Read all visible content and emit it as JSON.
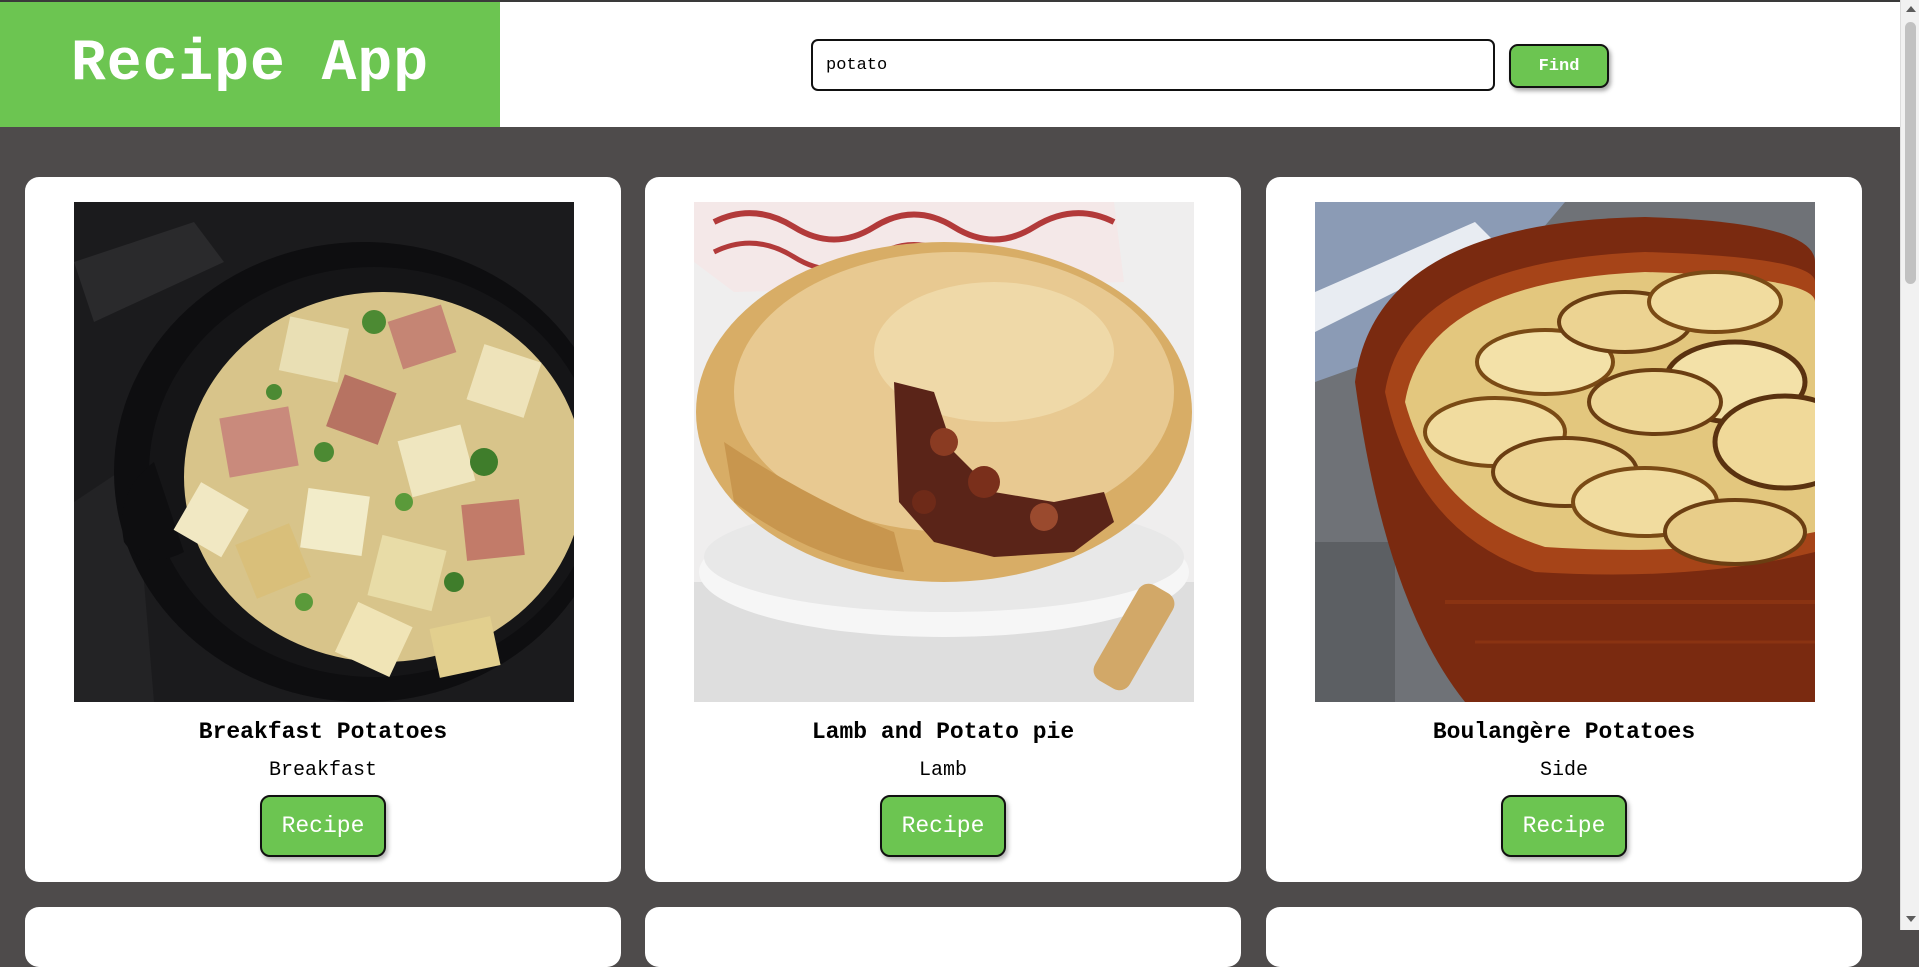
{
  "app": {
    "title": "Recipe App"
  },
  "search": {
    "value": "potato",
    "button_label": "Find"
  },
  "colors": {
    "accent": "#6cc551",
    "background": "#4e4b4b",
    "card": "#ffffff"
  },
  "meals": [
    {
      "name": "Breakfast Potatoes",
      "category": "Breakfast",
      "button_label": "Recipe",
      "image": "skillet-potatoes-image"
    },
    {
      "name": "Lamb and Potato pie",
      "category": "Lamb",
      "button_label": "Recipe",
      "image": "pie-image"
    },
    {
      "name": "Boulangère Potatoes",
      "category": "Side",
      "button_label": "Recipe",
      "image": "sliced-potatoes-dish-image"
    }
  ]
}
